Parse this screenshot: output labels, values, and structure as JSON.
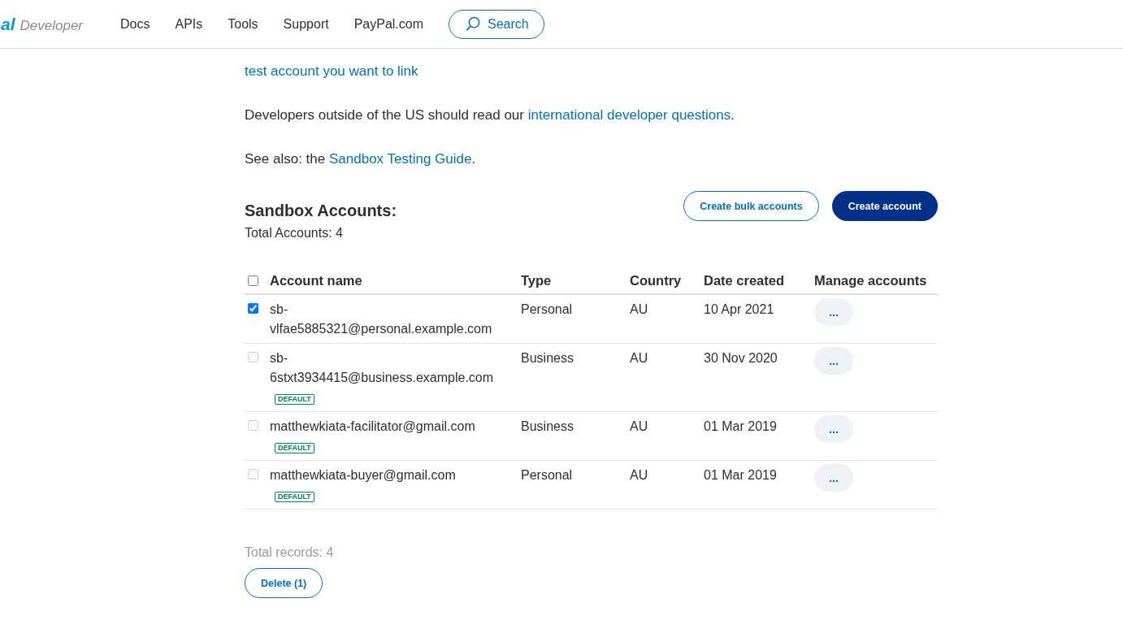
{
  "header": {
    "logo_text": "al",
    "logo_subtitle": "Developer",
    "nav": [
      "Docs",
      "APIs",
      "Tools",
      "Support",
      "PayPal.com"
    ],
    "search_button": "Search"
  },
  "intro": [
    {
      "link": "test account you want to link"
    },
    {
      "text": "Developers outside of the US should read our ",
      "link": "international developer questions",
      "after": "."
    },
    {
      "text": "See also: the ",
      "link": "Sandbox Testing Guide",
      "after": "."
    }
  ],
  "sandbox": {
    "title": "Sandbox Accounts:",
    "total": "Total Accounts: 4",
    "buttons": [
      {
        "label": "Create bulk accounts",
        "kind": "outline"
      },
      {
        "label": "Create account",
        "kind": "primary"
      }
    ]
  },
  "table": {
    "select_all": {
      "checked": false
    },
    "columns": [
      "Account name",
      "Type",
      "Country",
      "Date created",
      "Manage accounts"
    ],
    "rows": [
      {
        "checked": true,
        "disabled": false,
        "account_name": "sb-vlfae5885321@personal.example.com",
        "type": "Personal",
        "country": "AU",
        "date_created": "10 Apr 2021",
        "menu": "..."
      },
      {
        "checked": false,
        "disabled": true,
        "account_name": "sb-6stxt3934415@business.example.com",
        "badge": "DEFAULT",
        "type": "Business",
        "country": "AU",
        "date_created": "30 Nov 2020",
        "menu": "..."
      },
      {
        "checked": false,
        "disabled": true,
        "account_name": "matthewkiata-facilitator@gmail.com",
        "badge": "DEFAULT",
        "type": "Business",
        "country": "AU",
        "date_created": "01 Mar 2019",
        "menu": "..."
      },
      {
        "checked": false,
        "disabled": true,
        "account_name": "matthewkiata-buyer@gmail.com",
        "badge": "DEFAULT",
        "type": "Personal",
        "country": "AU",
        "date_created": "01 Mar 2019",
        "menu": "..."
      }
    ]
  },
  "footer": {
    "total_records": "Total records: 4",
    "delete_button": "Delete (1)"
  }
}
